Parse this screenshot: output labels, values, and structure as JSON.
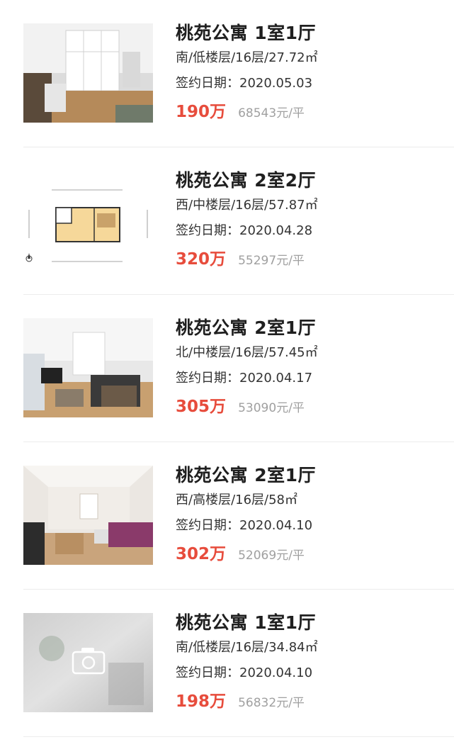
{
  "listings": [
    {
      "title": "桃苑公寓 1室1厅",
      "meta": "南/低楼层/16层/27.72㎡",
      "date": "签约日期：2020.05.03",
      "price": "190万",
      "unit_price": "68543元/平",
      "thumb": "room-photo"
    },
    {
      "title": "桃苑公寓 2室2厅",
      "meta": "西/中楼层/16层/57.87㎡",
      "date": "签约日期：2020.04.28",
      "price": "320万",
      "unit_price": "55297元/平",
      "thumb": "floor-plan"
    },
    {
      "title": "桃苑公寓 2室1厅",
      "meta": "北/中楼层/16层/57.45㎡",
      "date": "签约日期：2020.04.17",
      "price": "305万",
      "unit_price": "53090元/平",
      "thumb": "room-photo"
    },
    {
      "title": "桃苑公寓 2室1厅",
      "meta": "西/高楼层/16层/58㎡",
      "date": "签约日期：2020.04.10",
      "price": "302万",
      "unit_price": "52069元/平",
      "thumb": "room-photo"
    },
    {
      "title": "桃苑公寓 1室1厅",
      "meta": "南/低楼层/16层/34.84㎡",
      "date": "签约日期：2020.04.10",
      "price": "198万",
      "unit_price": "56832元/平",
      "thumb": "placeholder-camera"
    }
  ],
  "colors": {
    "price": "#e74c3c",
    "unit_price": "#a0a0a0",
    "title": "#1f1f1f"
  }
}
